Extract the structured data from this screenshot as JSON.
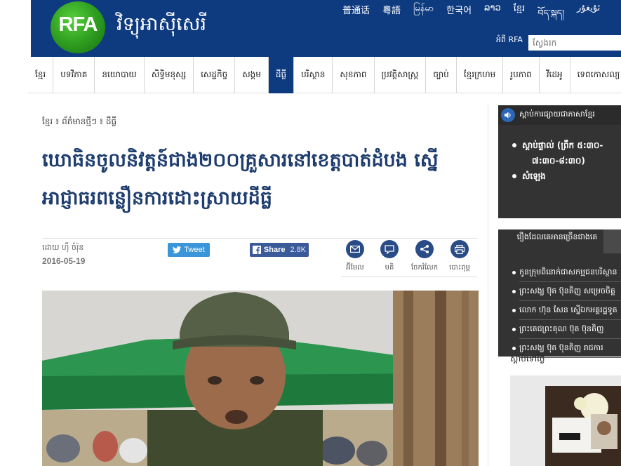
{
  "header": {
    "logo_text": "RFA",
    "site_title": "វិទ្យុអាស៊ីសេរី",
    "languages": [
      "普通话",
      "粵語",
      "မြန်မာ",
      "한국어",
      "ລາວ",
      "ខ្មែរ",
      "བོད་སྐད།",
      "ئۇيغۇر"
    ],
    "about_label": "អំពី RFA",
    "search_placeholder": "ស្វែងរក"
  },
  "nav": {
    "items": [
      "ខ្មែរ",
      "បទវិភាគ",
      "នយោបាយ",
      "សិទ្ធិមនុស្ស",
      "សេដ្ឋកិច្ច",
      "សង្គម",
      "ដីធ្លី",
      "បរិស្ថាន",
      "សុខភាព",
      "ប្រវត្តិសាស្ត្រ",
      "ច្បាប់",
      "ខ្មែរក្រហម",
      "រូបភាព",
      "វីដេអូ",
      "ទេពកោសល្យ"
    ],
    "active_index": 6
  },
  "article": {
    "breadcrumb": "ខ្មែរ ៖ ព័ត៌មានថ្មីៗ ៖ ដីធ្លី",
    "headline": "ឃោធិនចូលនិវត្តន៍ជាង២០០គ្រួសារនៅខេត្តបាត់ដំបង ស្នើអាជ្ញាធរពន្លឿនការដោះស្រាយដីធ្លី",
    "author": "ដោយ ហ៊ឹ ចំរ៉ុន",
    "date": "2016-05-19",
    "tweet_label": "Tweet",
    "share_label": "Share",
    "share_count": "2.8K",
    "actions": [
      {
        "label": "អ៊ីមែល",
        "icon": "email-icon"
      },
      {
        "label": "មតិ",
        "icon": "comment-icon"
      },
      {
        "label": "ចែករំលែក",
        "icon": "share-icon"
      },
      {
        "label": "បោះពុម្ព",
        "icon": "print-icon"
      }
    ]
  },
  "sidebar": {
    "radio_title": "ស្ដាប់ការផ្សាយជាភាសាខ្មែរ",
    "radio_items": [
      "ស្ដាប់ផ្ទាល់ (ព្រឹក ៥:៣០-",
      "៧:៣០-៨:៣០)",
      "សំឡេង"
    ],
    "popular_tab": "រឿងដែលគេអានច្រើនជាងគេ",
    "popular_items": [
      "កូនក្រុមពិនោក់ជាសកម្មជនបរិស្ថាន",
      "ព្រះសង្ឃ ប៊ុត ប៊ុនតិញ សម្រេចចិត្ត",
      "លោក ហ៊ុន សែន ស្នើឯកអគ្គរដ្ឋទូត",
      "ព្រះតេជព្រះគុណ ប៊ុត ប៊ុនតិញ",
      "ព្រះសង្ឃ ប៊ុត ប៊ុនតិញ រាជការ"
    ],
    "section_label": "ស្ដាប់ទៅថ្ងៃ"
  },
  "colors": {
    "brand_blue": "#0e3b80",
    "headline_blue": "#1e3d6e",
    "tweet_blue": "#3b95d9",
    "facebook_blue": "#3b5a9a",
    "sidebar_dark": "#333333"
  }
}
